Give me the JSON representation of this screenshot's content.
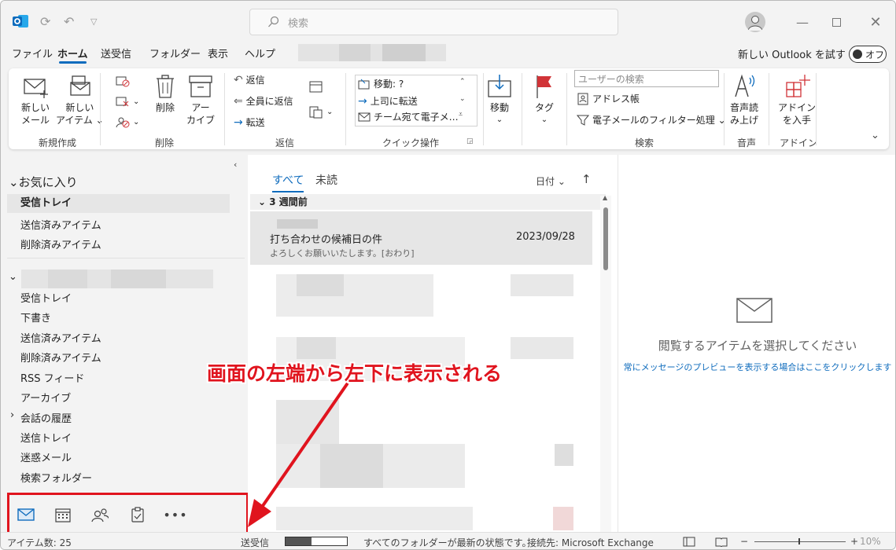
{
  "search": {
    "placeholder": "検索"
  },
  "menu": {
    "tabs": [
      "ファイル",
      "ホーム",
      "送受信",
      "フォルダー",
      "表示",
      "ヘルプ"
    ],
    "active": "ホーム",
    "new_outlook_label": "新しい Outlook を試す",
    "toggle_label": "オフ"
  },
  "ribbon": {
    "groups": {
      "new": "新規作成",
      "delete": "削除",
      "respond": "返信",
      "quick_steps": "クイック操作",
      "move": "",
      "tags": "",
      "find": "検索",
      "speech": "音声",
      "addins": "アドイン"
    },
    "new_mail": [
      "新しい",
      "メール"
    ],
    "new_items": [
      "新しい",
      "アイテム ⌄"
    ],
    "delete_btn": "削除",
    "archive": [
      "アー",
      "カイブ"
    ],
    "reply": "返信",
    "reply_all": "全員に返信",
    "forward": "転送",
    "quick_move": "移動: ?",
    "quick_manager": "上司に転送",
    "quick_team": "チーム宛て電子メ…",
    "move_btn": "移動",
    "tag_btn": "タグ",
    "user_search_placeholder": "ユーザーの検索",
    "address_book": "アドレス帳",
    "filter_email": "電子メールのフィルター処理 ⌄",
    "read_aloud": [
      "音声読",
      "み上げ"
    ],
    "get_addins": [
      "アドイン",
      "を入手"
    ]
  },
  "nav": {
    "favorites_header": "お気に入り",
    "favorites": [
      "受信トレイ",
      "送信済みアイテム",
      "削除済みアイテム"
    ],
    "account_folders": [
      "受信トレイ",
      "下書き",
      "送信済みアイテム",
      "削除済みアイテム",
      "RSS フィード",
      "アーカイブ",
      "会話の履歴",
      "送信トレイ",
      "迷惑メール",
      "検索フォルダー"
    ]
  },
  "messages": {
    "tab_all": "すべて",
    "tab_unread": "未読",
    "sort_label": "日付 ⌄",
    "sort_arrow": "↑",
    "group_header": "3 週間前",
    "selected": {
      "subject": "打ち合わせの候補日の件",
      "date": "2023/09/28",
      "preview": "よろしくお願いいたします。[おわり]"
    }
  },
  "reading_pane": {
    "message": "閲覧するアイテムを選択してください",
    "link": "常にメッセージのプレビューを表示する場合はここをクリックします"
  },
  "status": {
    "items": "アイテム数: 25",
    "send_receive": "送受信",
    "progress": 0.42,
    "folders_status": "すべてのフォルダーが最新の状態です。",
    "connection": "接続先: Microsoft Exchange",
    "zoom": "10%"
  },
  "annotation": "画面の左端から左下に表示される",
  "colors": {
    "accent": "#0f6cbd",
    "annotation_red": "#e0141e",
    "flag_red": "#d13438"
  }
}
